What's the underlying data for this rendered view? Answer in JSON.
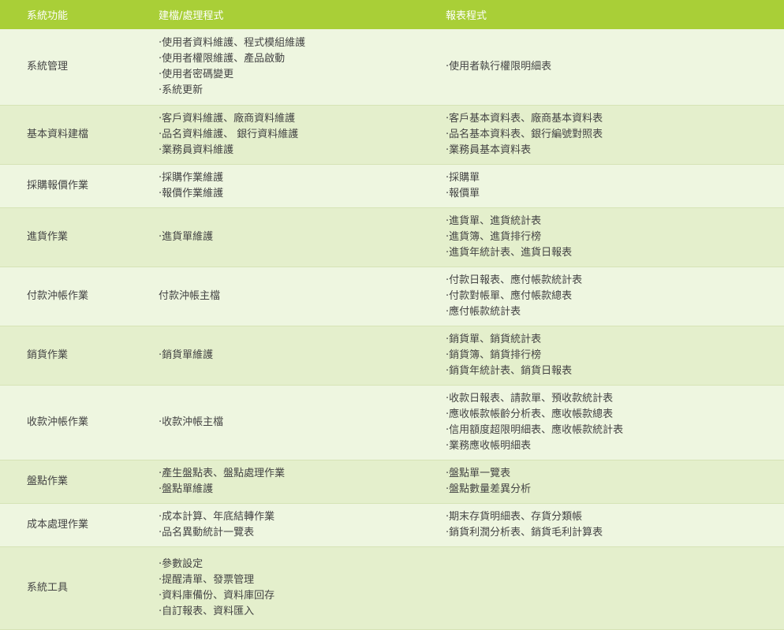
{
  "header": {
    "col1": "系統功能",
    "col2": "建檔/處理程式",
    "col3": "報表程式"
  },
  "rows": [
    {
      "name": "系統管理",
      "build": [
        "·使用者資料維護、程式模組維護",
        "·使用者權限維護、產品啟動",
        "·使用者密碼變更",
        "·系統更新"
      ],
      "report": [
        "·使用者執行權限明細表"
      ]
    },
    {
      "name": "基本資料建檔",
      "build": [
        "·客戶資料維護、廠商資料維護",
        "·品名資料維護、 銀行資料維護",
        "·業務員資料維護"
      ],
      "report": [
        "·客戶基本資料表、廠商基本資料表",
        "·品名基本資料表、銀行編號對照表",
        "·業務員基本資料表"
      ]
    },
    {
      "name": "採購報價作業",
      "build": [
        "·採購作業維護",
        "·報價作業維護"
      ],
      "report": [
        "·採購單",
        "·報價單"
      ]
    },
    {
      "name": "進貨作業",
      "build": [
        "·進貨單維護"
      ],
      "report": [
        "·進貨單、進貨統計表",
        "·進貨簿、進貨排行榜",
        "·進貨年統計表、進貨日報表"
      ]
    },
    {
      "name": "付款沖帳作業",
      "build": [
        "付款沖帳主檔"
      ],
      "report": [
        "·付款日報表、應付帳款統計表",
        "·付款對帳單、應付帳款總表",
        "·應付帳款統計表"
      ]
    },
    {
      "name": "銷貨作業",
      "build": [
        "·銷貨單維護"
      ],
      "report": [
        "·銷貨單、銷貨統計表",
        "·銷貨簿、銷貨排行榜",
        "·銷貨年統計表、銷貨日報表"
      ]
    },
    {
      "name": "收款沖帳作業",
      "build": [
        "·收款沖帳主檔"
      ],
      "report": [
        "·收款日報表、請款單、預收款統計表",
        "·應收帳款帳齡分析表、應收帳款總表",
        "·信用額度超限明細表、應收帳款統計表",
        "·業務應收帳明細表"
      ]
    },
    {
      "name": "盤點作業",
      "build": [
        "·產生盤點表、盤點處理作業",
        "·盤點單維護"
      ],
      "report": [
        "·盤點單一覽表",
        "·盤點數量差異分析"
      ]
    },
    {
      "name": "成本處理作業",
      "build": [
        "·成本計算、年底結轉作業",
        "·品名異動統計一覽表"
      ],
      "report": [
        "·期末存貨明細表、存貨分類帳",
        "·銷貨利潤分析表、銷貨毛利計算表"
      ]
    },
    {
      "name": "系統工具",
      "build": [
        "·參數設定",
        "·提醒清單、發票管理",
        "·資料庫備份、資料庫回存",
        "·自訂報表、資料匯入"
      ],
      "report": []
    }
  ]
}
